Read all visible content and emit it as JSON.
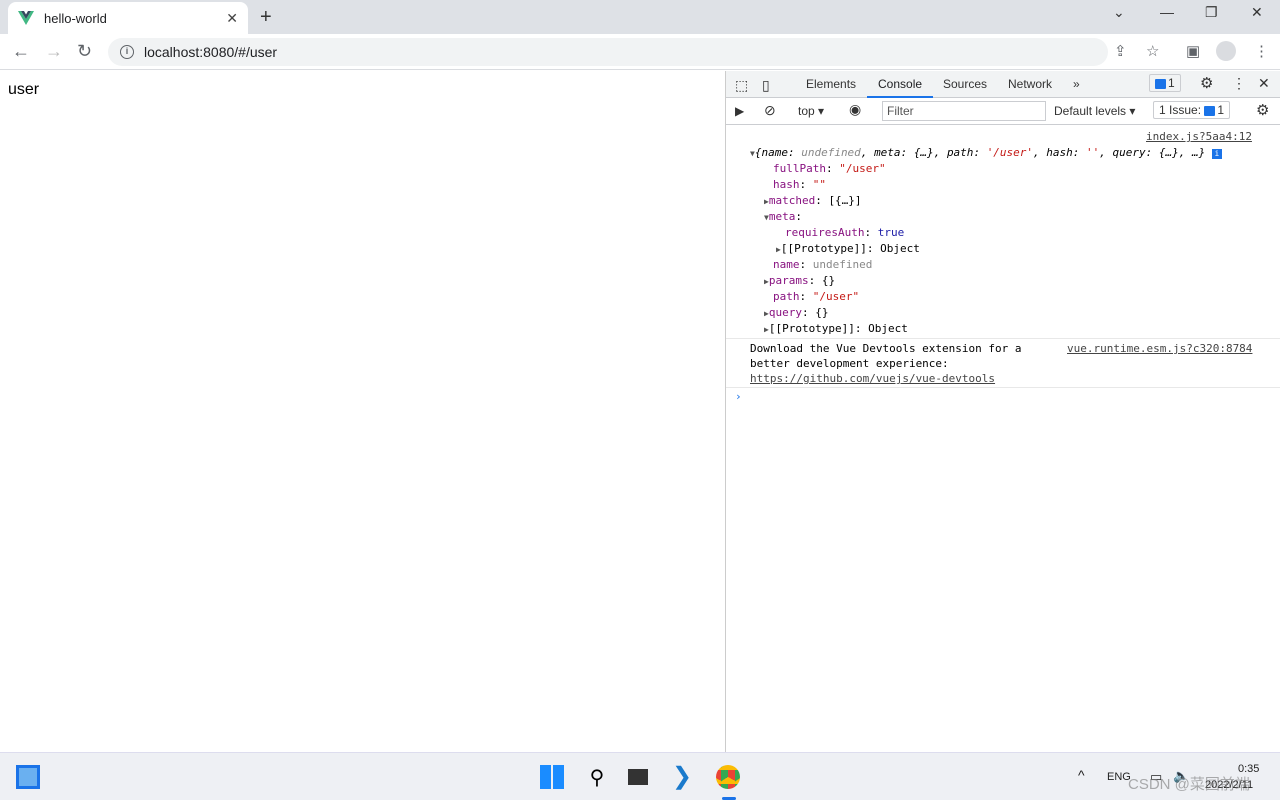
{
  "browser": {
    "tab_title": "hello-world",
    "url": "localhost:8080/#/user"
  },
  "page": {
    "text": "user"
  },
  "devtools": {
    "tabs": [
      "Elements",
      "Console",
      "Sources",
      "Network"
    ],
    "active_tab": "Console",
    "message_count": "1",
    "context": "top",
    "filter_placeholder": "Filter",
    "levels": "Default levels",
    "issues": "1 Issue:",
    "issue_count": "1",
    "console": {
      "src1": "index.js?5aa4:12",
      "summary": {
        "open": "{",
        "name_k": "name",
        "name_v": "undefined",
        "meta_k": "meta",
        "meta_v": "{…}",
        "path_k": "path",
        "path_v": "'/user'",
        "hash_k": "hash",
        "hash_v": "''",
        "query_k": "query",
        "query_v": "{…}",
        "more": "…}"
      },
      "props": [
        {
          "k": "fullPath",
          "v": "\"/user\""
        },
        {
          "k": "hash",
          "v": "\"\""
        },
        {
          "k": "matched",
          "v": "[{…}]"
        },
        {
          "k": "meta",
          "v": ""
        },
        {
          "k": "requiresAuth",
          "v": "true"
        },
        {
          "k": "[[Prototype]]",
          "v": "Object"
        },
        {
          "k": "name",
          "v": "undefined"
        },
        {
          "k": "params",
          "v": "{}"
        },
        {
          "k": "path",
          "v": "\"/user\""
        },
        {
          "k": "query",
          "v": "{}"
        },
        {
          "k": "[[Prototype]]",
          "v": "Object"
        }
      ],
      "msg2": [
        "Download the Vue Devtools extension for a",
        "better development experience:",
        "https://github.com/vuejs/vue-devtools"
      ],
      "src2": "vue.runtime.esm.js?c320:8784"
    }
  },
  "taskbar": {
    "lang": "ENG",
    "time": "0:35",
    "date": "2022/2/11",
    "watermark": "CSDN @菜园前端"
  }
}
